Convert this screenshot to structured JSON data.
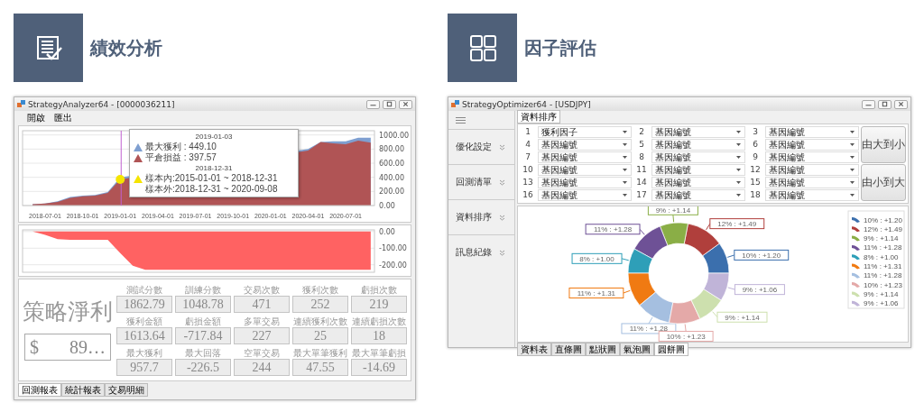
{
  "analyzer": {
    "heading": "績效分析",
    "window": {
      "title": "StrategyAnalyzer64 - [0000036211]",
      "menu": [
        "開啟",
        "匯出"
      ],
      "equity_chart": {
        "chart_data": {
          "type": "area",
          "categories": [
            null,
            "2018-07-01",
            null,
            null,
            "2018-10-01",
            null,
            null,
            "2019-01-01",
            null,
            null,
            "2019-04-01",
            null,
            null,
            "2019-07-01",
            null,
            null,
            "2019-10-01",
            null,
            null,
            "2020-01-01",
            null,
            null,
            "2020-04-01",
            null,
            null,
            "2020-07-01",
            null,
            null
          ],
          "ylim": [
            0,
            1060
          ],
          "grid": true,
          "series": [
            {
              "color": "#7f9fd0",
              "values": [
                20,
                30,
                60,
                120,
                140,
                150,
                190,
                400,
                null,
                null,
                null,
                null,
                null,
                null,
                null,
                null,
                null,
                null,
                null,
                null,
                null,
                null,
                800,
                900,
                910,
                910,
                960,
                960
              ]
            },
            {
              "color": "#b05455",
              "values": [
                20,
                30,
                50,
                110,
                130,
                140,
                180,
                370,
                null,
                null,
                null,
                null,
                null,
                null,
                null,
                null,
                null,
                null,
                null,
                null,
                null,
                null,
                780,
                900,
                880,
                870,
                920,
                890
              ]
            }
          ],
          "yticks": [
            {
              "value": 0,
              "label": "0.00"
            },
            {
              "value": 200,
              "label": "200.00"
            },
            {
              "value": 400,
              "label": "400.00"
            },
            {
              "value": 600,
              "label": "600.00"
            },
            {
              "value": 800,
              "label": "800.00"
            },
            {
              "value": 1000,
              "label": "1000.00"
            }
          ]
        },
        "tooltip": {
          "date": "2019-01-03",
          "rows": [
            {
              "text": "最大獲利 : 449.10",
              "color": "#7f9fd0"
            },
            {
              "text": "平倉損益 : 397.57",
              "color": "#b05455"
            }
          ],
          "split_date": "2018-12-31",
          "sample_rows": [
            {
              "text": "樣本內:2015-01-01 ~ 2018-12-31",
              "color": "#f5e400"
            },
            {
              "text": "樣本外:2018-12-31 ~ 2020-09-08"
            }
          ]
        }
      },
      "drawdown_chart": {
        "chart_data": {
          "type": "area",
          "grid": true,
          "categories": [
            null,
            null,
            null,
            null,
            null,
            null,
            null,
            null,
            null,
            null,
            null,
            null,
            null,
            null,
            null,
            null,
            null,
            null,
            null,
            null,
            null,
            null,
            null,
            null,
            null,
            null,
            null,
            null
          ],
          "ylim": [
            -245,
            10
          ],
          "series": [
            {
              "color": "#ff6262",
              "values": [
                0,
                -20,
                -45,
                -50,
                -50,
                -50,
                -50,
                -130,
                -205,
                -230,
                -230,
                -230,
                -230,
                -230,
                -230,
                -230,
                -230,
                -230,
                -230,
                -230,
                -230,
                -230,
                -230,
                -230,
                -230,
                -230,
                -230,
                -230
              ]
            }
          ],
          "yticks": [
            {
              "value": 0,
              "label": "0.00"
            },
            {
              "value": -100,
              "label": "-100.00"
            },
            {
              "value": -200,
              "label": "-200.00"
            }
          ]
        }
      },
      "net_profit": {
        "label": "策略淨利",
        "currency": "$",
        "value": "89…"
      },
      "stats": [
        {
          "label": "測試分數",
          "value": "1862.79"
        },
        {
          "label": "訓練分數",
          "value": "1048.78"
        },
        {
          "label": "交易次數",
          "value": "471"
        },
        {
          "label": "獲利次數",
          "value": "252"
        },
        {
          "label": "虧損次數",
          "value": "219"
        },
        {
          "label": "獲利金額",
          "value": "1613.64"
        },
        {
          "label": "虧損金額",
          "value": "-717.84"
        },
        {
          "label": "多單交易",
          "value": "227"
        },
        {
          "label": "連續獲利次數",
          "value": "25"
        },
        {
          "label": "連續虧損次數",
          "value": "18"
        },
        {
          "label": "最大獲利",
          "value": "957.7"
        },
        {
          "label": "最大回落",
          "value": "-226.5"
        },
        {
          "label": "空單交易",
          "value": "244"
        },
        {
          "label": "最大單筆獲利",
          "value": "47.55"
        },
        {
          "label": "最大單筆虧損",
          "value": "-14.69"
        }
      ],
      "tabs": [
        {
          "label": "回測報表",
          "selected": true
        },
        {
          "label": "統計報表",
          "selected": false
        },
        {
          "label": "交易明細",
          "selected": false
        }
      ]
    }
  },
  "optimizer": {
    "heading": "因子評估",
    "window": {
      "title": "StrategyOptimizer64 - [USDJPY]",
      "sidebar": {
        "items": [
          {
            "label": "優化設定"
          },
          {
            "label": "回測清單"
          },
          {
            "label": "資料排序"
          },
          {
            "label": "訊息紀錄"
          }
        ]
      },
      "tabs": [
        {
          "label": "資料排序",
          "selected": true
        }
      ],
      "sort_fields": [
        {
          "number": "1",
          "value": "獲利因子"
        },
        {
          "number": "2",
          "value": "基因編號"
        },
        {
          "number": "3",
          "value": "基因編號"
        },
        {
          "number": "4",
          "value": "基因編號"
        },
        {
          "number": "5",
          "value": "基因編號"
        },
        {
          "number": "6",
          "value": "基因編號"
        },
        {
          "number": "7",
          "value": "基因編號"
        },
        {
          "number": "8",
          "value": "基因編號"
        },
        {
          "number": "9",
          "value": "基因編號"
        },
        {
          "number": "10",
          "value": "基因編號"
        },
        {
          "number": "11",
          "value": "基因編號"
        },
        {
          "number": "12",
          "value": "基因編號"
        },
        {
          "number": "13",
          "value": "基因編號"
        },
        {
          "number": "14",
          "value": "基因編號"
        },
        {
          "number": "15",
          "value": "基因編號"
        },
        {
          "number": "16",
          "value": "基因編號"
        },
        {
          "number": "17",
          "value": "基因編號"
        },
        {
          "number": "18",
          "value": "基因編號"
        }
      ],
      "buttons": [
        "由大到小",
        "由小到大"
      ],
      "chart": {
        "chart_data": {
          "type": "donut",
          "legend": "right",
          "categories": [
            "10% : +1.20",
            "12% : +1.49",
            "9% : +1.14",
            "11% : +1.28",
            "8% : +1.00",
            "11% : +1.31",
            "11% : +1.28",
            "10% : +1.23",
            "9% : +1.14",
            "9% : +1.06"
          ],
          "values": [
            10,
            12,
            9,
            11,
            8,
            11,
            11,
            10,
            9,
            9
          ],
          "colors": [
            "#3b6fad",
            "#b03f3c",
            "#8aae46",
            "#6e5196",
            "#2e9fb8",
            "#f07a12",
            "#a5bfe0",
            "#e4a9a8",
            "#cde0ae",
            "#c0b4d8"
          ],
          "value_labels": [
            "10% : +1.20",
            "12% : +1.49",
            "9% : +1.14",
            "11% : +1.28",
            "8% : +1.00",
            "11% : +1.31",
            "11% : +1.28",
            "10% : +1.23",
            "9% : +1.14",
            "9% : +1.06"
          ]
        }
      },
      "view_tabs": [
        {
          "label": "資料表",
          "selected": false
        },
        {
          "label": "直條圖",
          "selected": false
        },
        {
          "label": "點狀圖",
          "selected": false
        },
        {
          "label": "氣泡圖",
          "selected": false
        },
        {
          "label": "圓餅圖",
          "selected": true
        }
      ]
    }
  }
}
